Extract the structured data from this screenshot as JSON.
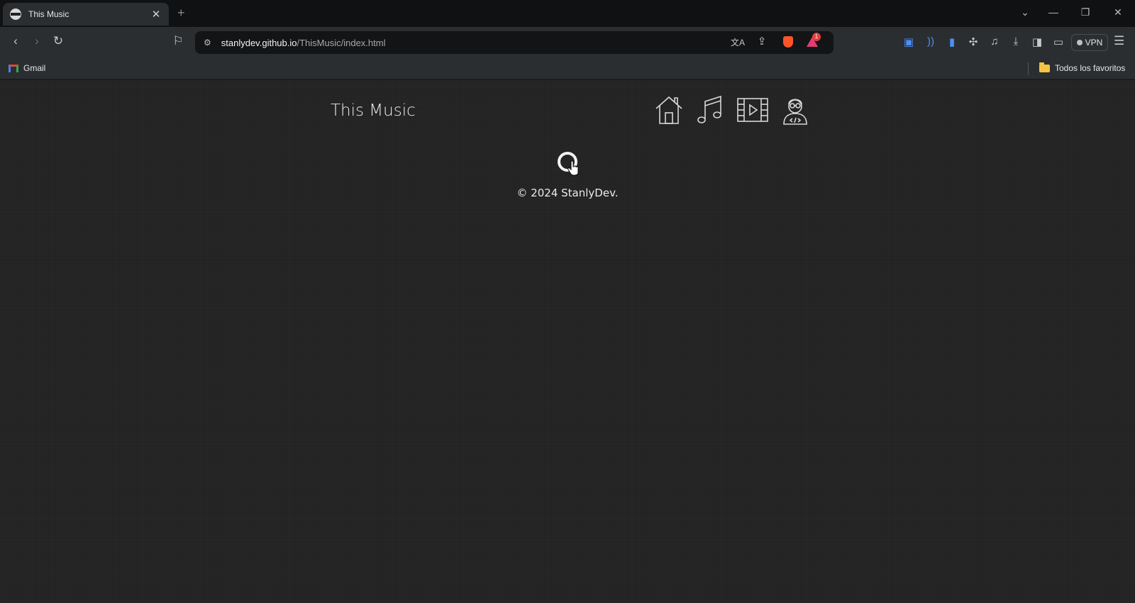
{
  "browser": {
    "tab": {
      "title": "This Music",
      "close_glyph": "✕",
      "icon": "site-favicon"
    },
    "new_tab_glyph": "+",
    "window_controls": {
      "dropdown": "⌄",
      "minimize": "—",
      "restore": "❐",
      "close": "✕"
    },
    "toolbar": {
      "back_glyph": "‹",
      "forward_glyph": "›",
      "reload_glyph": "↻",
      "bookmark_glyph": "⚐",
      "site_info_glyph": "⚙",
      "url_host": "stanlydev.github.io",
      "url_path": "/ThisMusic/index.html",
      "translate_glyph": "文A",
      "share_glyph": "⇪",
      "rewards_badge": "1",
      "extensions": [
        "translate-ext-icon",
        "speech-ext-icon",
        "wallet-ext-icon",
        "puzzle-icon",
        "music-note-icon",
        "download-icon",
        "sidebar-icon",
        "crypto-wallet-icon"
      ],
      "ext_glyphs": [
        "▣",
        "))",
        "▮",
        "✣",
        "♫",
        "⤓",
        "◨",
        "▭"
      ],
      "vpn_label": "VPN",
      "menu_glyph": "☰"
    },
    "bookmarks": {
      "gmail": "Gmail",
      "all_favorites": "Todos los favoritos"
    }
  },
  "page": {
    "site_title": "This Music",
    "nav": [
      {
        "name": "home",
        "icon": "home-icon"
      },
      {
        "name": "music",
        "icon": "music-note-icon"
      },
      {
        "name": "video",
        "icon": "film-icon"
      },
      {
        "name": "developer",
        "icon": "developer-icon"
      }
    ],
    "footer": "© 2024 StanlyDev.",
    "colors": {
      "background": "#222222",
      "text": "#ececec",
      "chrome": "#2b2e31",
      "tabbar": "#0f1112"
    }
  }
}
